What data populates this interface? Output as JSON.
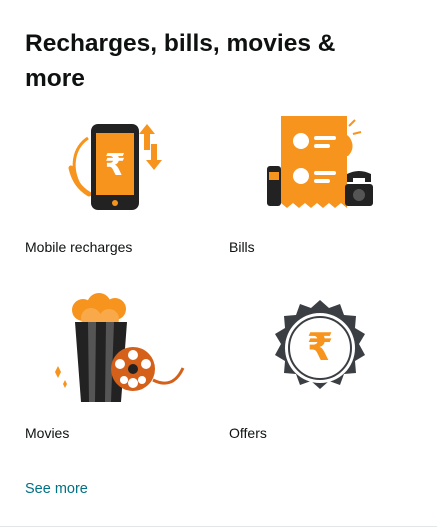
{
  "card": {
    "title": "Recharges, bills, movies & more",
    "see_more_label": "See more",
    "link_color": "#007185",
    "accent_color": "#f7941d"
  },
  "tiles": [
    {
      "label": "Mobile recharges",
      "icon": "mobile-rupee-icon"
    },
    {
      "label": "Bills",
      "icon": "bill-receipt-icon"
    },
    {
      "label": "Movies",
      "icon": "popcorn-film-reel-icon"
    },
    {
      "label": "Offers",
      "icon": "rupee-badge-icon"
    }
  ]
}
